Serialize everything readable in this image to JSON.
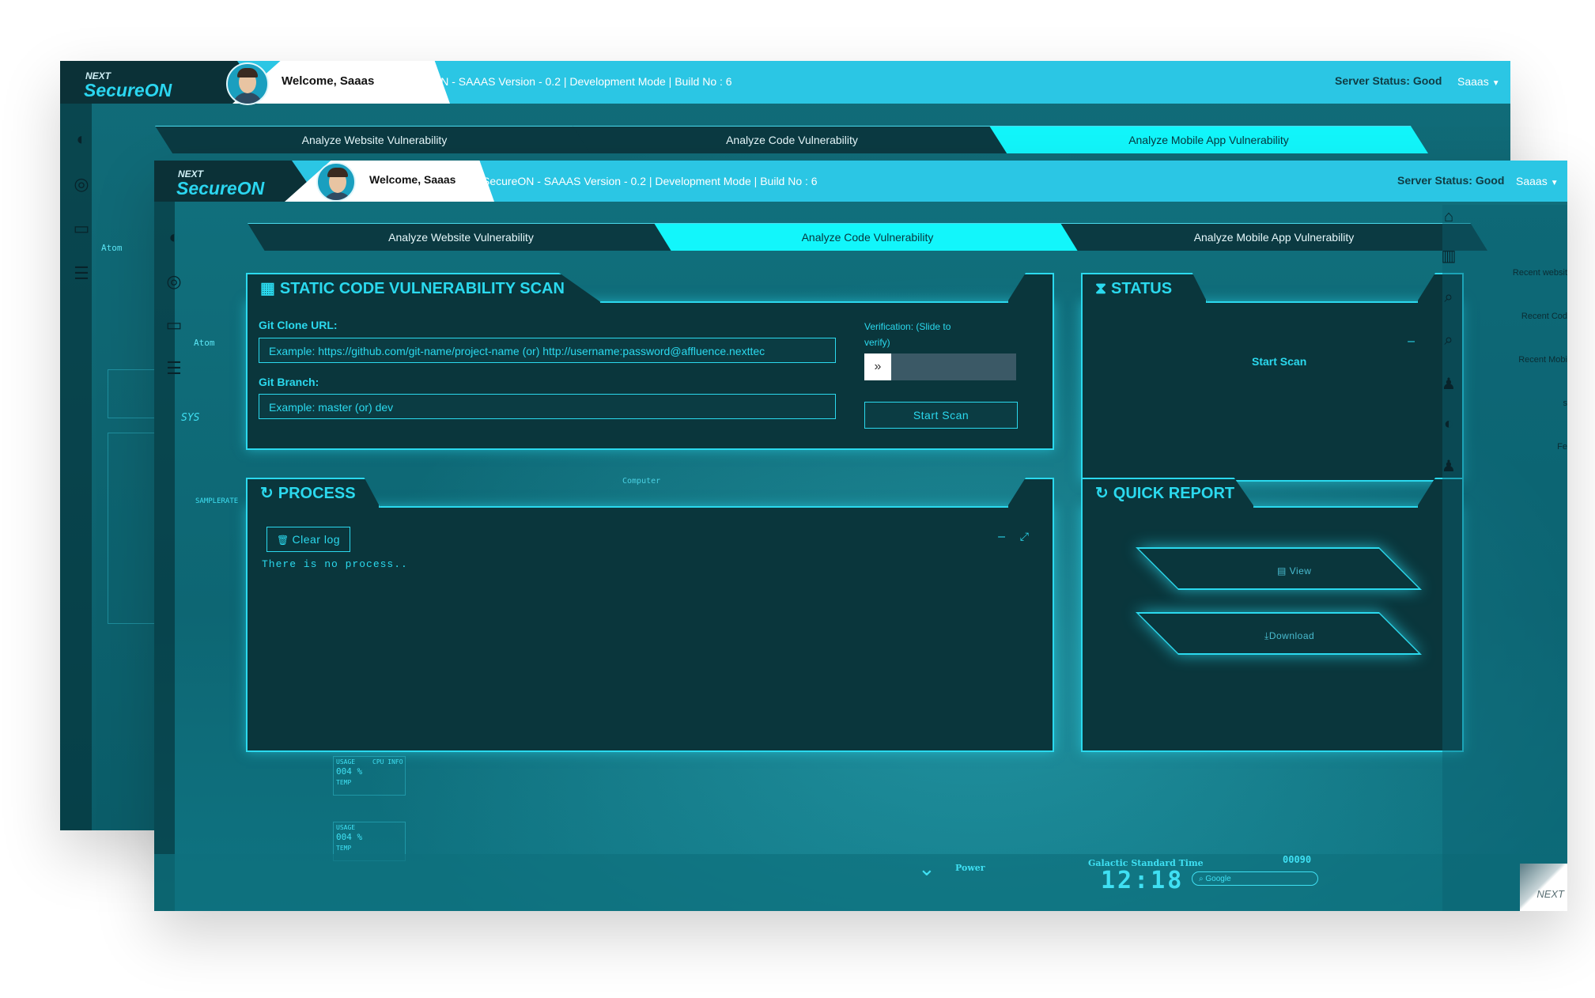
{
  "back_window": {
    "logo": {
      "prefix": "NEXT",
      "name": "SecureON"
    },
    "welcome": "Welcome, Saaas",
    "version": "SecureON - SAAAS Version - 0.2 | Development Mode | Build No : 6",
    "server_status": "Server Status: Good",
    "user": "Saaas",
    "tabs": [
      {
        "label": "Analyze Website Vulnerability"
      },
      {
        "label": "Analyze Code Vulnerability"
      },
      {
        "label": "Analyze Mobile App Vulnerability"
      }
    ],
    "side_label": "Atom"
  },
  "front_window": {
    "logo": {
      "prefix": "NEXT",
      "name": "SecureON"
    },
    "welcome": "Welcome, Saaas",
    "version": "SecureON - SAAAS Version - 0.2 | Development Mode | Build No : 6",
    "server_status": "Server Status: Good",
    "user": "Saaas",
    "tabs": [
      {
        "label": "Analyze Website Vulnerability"
      },
      {
        "label": "Analyze Code Vulnerability",
        "active": true
      },
      {
        "label": "Analyze Mobile App Vulnerability"
      }
    ],
    "scan_panel": {
      "title": "STATIC CODE VULNERABILITY SCAN",
      "git_url_label": "Git Clone URL:",
      "git_url_placeholder": "Example: https://github.com/git-name/project-name (or) http://username:password@affluence.nexttec",
      "git_branch_label": "Git Branch:",
      "git_branch_placeholder": "Example: master (or) dev",
      "verification_label": "Verification: (Slide to verify)",
      "start_scan": "Start Scan"
    },
    "status_panel": {
      "title": "STATUS",
      "link": "Start Scan"
    },
    "process_panel": {
      "title": "PROCESS",
      "clear_log": "Clear log",
      "message": "There is no process.."
    },
    "report_panel": {
      "title": "QUICK REPORT",
      "view": "View",
      "download": "Download"
    },
    "right_links": [
      "Recent websit",
      "Recent Cod",
      "Recent Mobi",
      "s",
      "Fe"
    ],
    "hud": {
      "computer": "Computer",
      "power": "Power",
      "galactic_time_label": "Galactic Standard Time",
      "time": "12:18",
      "search": "Google",
      "counter": "00090",
      "sys": "SYS",
      "samplerate": "SAMPLERATE",
      "usage": "USAGE",
      "cpu_info": "CPU INFO",
      "temp": "TEMP",
      "usage_value": "004 %"
    },
    "corner_brand": "NEXT"
  },
  "colors": {
    "accent": "#2bd9ee",
    "topbar": "#2bc6e4",
    "active_tab": "#12f6fb",
    "panel_bg": "#0a363c"
  }
}
